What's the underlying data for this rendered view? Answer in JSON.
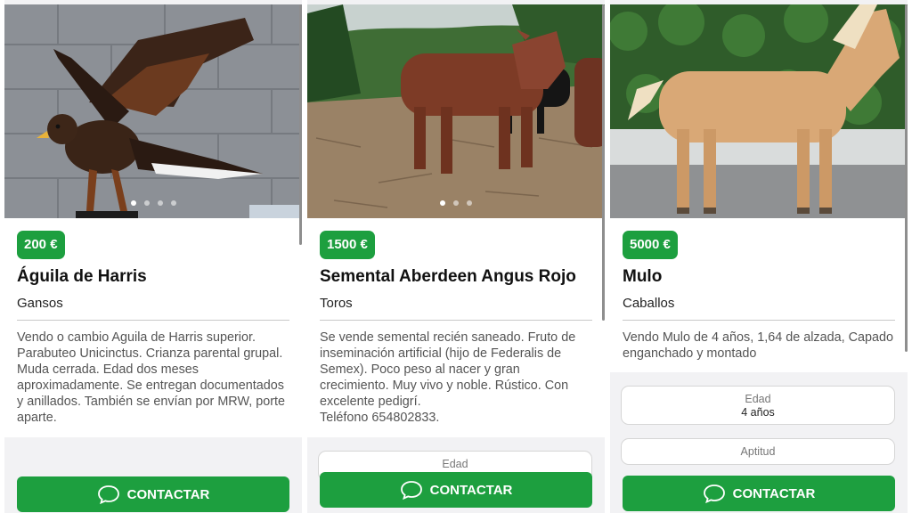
{
  "listings": [
    {
      "price": "200 €",
      "title": "Águila de Harris",
      "category": "Gansos",
      "description": "Vendo o cambio Aguila de Harris superior. Parabuteo Unicinctus. Crianza parental grupal. Muda cerrada. Edad dos meses aproximadamente. Se entregan documentados y anillados. También se envían por MRW, porte aparte.",
      "contact_label": "CONTACTAR"
    },
    {
      "price": "1500 €",
      "title": "Semental Aberdeen Angus Rojo",
      "category": "Toros",
      "description": "Se vende semental recién saneado. Fruto de inseminación artificial (hijo de Federalis de Semex). Poco peso al nacer y gran crecimiento. Muy vivo y noble. Rústico. Con excelente pedigrí.\nTeléfono 654802833.",
      "field_label": "Edad",
      "contact_label": "CONTACTAR"
    },
    {
      "price": "5000 €",
      "title": "Mulo",
      "category": "Caballos",
      "description": "Vendo Mulo de 4 años, 1,64 de alzada, Capado enganchado y montado",
      "fields": [
        {
          "label": "Edad",
          "value": "4 años"
        },
        {
          "label": "Aptitud",
          "value": ""
        }
      ],
      "contact_label": "CONTACTAR"
    }
  ],
  "colors": {
    "accent": "#1d9f3f",
    "background": "#f2f2f4"
  },
  "icons": {
    "contact": "chat-bubble-icon"
  }
}
